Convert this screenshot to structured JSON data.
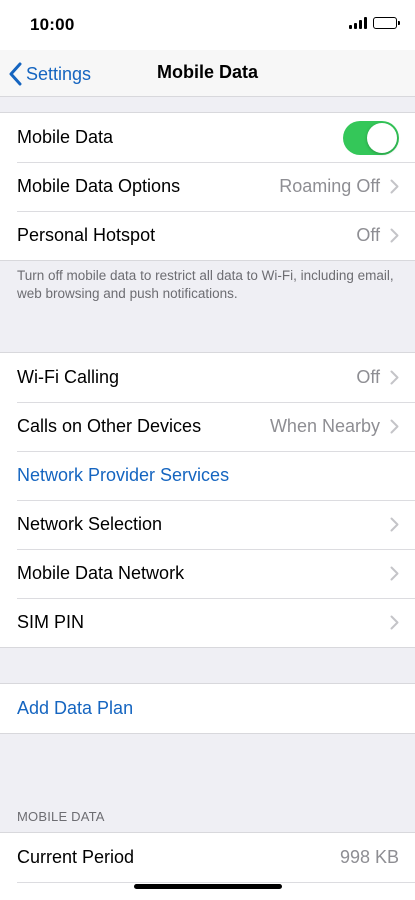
{
  "status": {
    "time": "10:00"
  },
  "nav": {
    "back_label": "Settings",
    "title": "Mobile Data"
  },
  "group1": {
    "mobile_data": {
      "label": "Mobile Data",
      "toggle_on": true
    },
    "options": {
      "label": "Mobile Data Options",
      "value": "Roaming Off"
    },
    "hotspot": {
      "label": "Personal Hotspot",
      "value": "Off"
    }
  },
  "footer_note": "Turn off mobile data to restrict all data to Wi-Fi, including email, web browsing and push notifications.",
  "group2": {
    "wifi_calling": {
      "label": "Wi-Fi Calling",
      "value": "Off"
    },
    "other_devices": {
      "label": "Calls on Other Devices",
      "value": "When Nearby"
    },
    "provider_services": {
      "label": "Network Provider Services"
    },
    "network_selection": {
      "label": "Network Selection"
    },
    "data_network": {
      "label": "Mobile Data Network"
    },
    "sim_pin": {
      "label": "SIM PIN"
    }
  },
  "group3": {
    "add_plan": {
      "label": "Add Data Plan"
    }
  },
  "usage_section": {
    "header": "MOBILE DATA",
    "current_period": {
      "label": "Current Period",
      "value": "998 KB"
    }
  },
  "colors": {
    "accent": "#1565C0",
    "toggle_on": "#34C759",
    "background": "#EFEFF4"
  }
}
